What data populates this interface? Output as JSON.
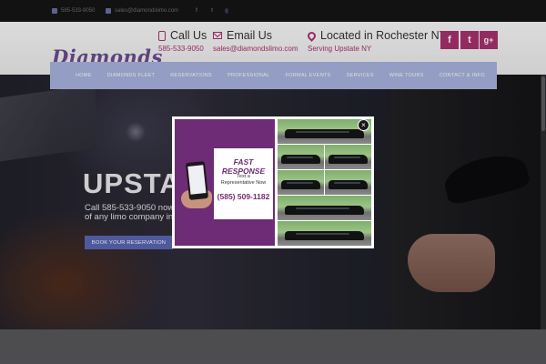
{
  "topbar": {
    "phone": "585-533-9050",
    "email": "sales@diamondslimo.com",
    "social_icons": [
      "facebook-icon",
      "twitter-icon",
      "google-plus-icon"
    ]
  },
  "header": {
    "logo_text": "Diamonds",
    "call": {
      "title": "Call Us",
      "sub": "585-533-9050"
    },
    "email": {
      "title": "Email Us",
      "sub": "sales@diamondslimo.com"
    },
    "location": {
      "title": "Located in Rochester NY",
      "sub": "Serving Upstate NY"
    },
    "social": [
      "f",
      "t",
      "g+"
    ],
    "accent_color": "#a8326f"
  },
  "nav": {
    "items": [
      "HOME",
      "DIAMONDS FLEET",
      "RESERVATIONS",
      "PROFESSIONAL",
      "FORMAL EVENTS",
      "SERVICES",
      "WINE TOURS",
      "CONTACT & INFO"
    ],
    "color": "#a9b3de"
  },
  "hero": {
    "title": "UPSTAT",
    "line1": "Call 585-533-9050 now",
    "line2": "of any limo company in",
    "button": "BOOK YOUR RESERVATION"
  },
  "popup": {
    "headline": "FAST RESPONSE",
    "text_line1": "Text a",
    "text_line2": "Representative Now",
    "phone": "(585) 509-1182",
    "close_label": "×",
    "panel_color": "#6e2b76"
  }
}
